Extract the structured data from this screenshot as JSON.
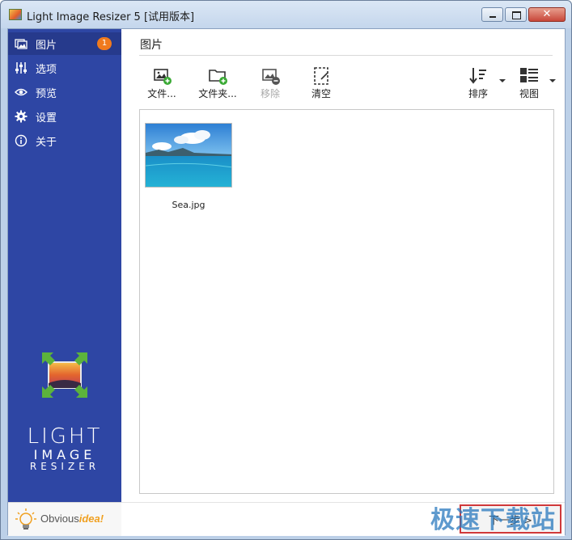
{
  "window": {
    "title": "Light Image Resizer 5  [试用版本]",
    "close_label": "✕"
  },
  "sidebar": {
    "items": [
      {
        "label": "图片",
        "icon": "images-icon",
        "badge": "1",
        "active": true
      },
      {
        "label": "选项",
        "icon": "sliders-icon"
      },
      {
        "label": "预览",
        "icon": "eye-icon"
      },
      {
        "label": "设置",
        "icon": "gear-icon"
      },
      {
        "label": "关于",
        "icon": "info-icon"
      }
    ],
    "logo": {
      "line1": "LIGHT",
      "line2": "IMAGE",
      "line3": "RESIZER"
    },
    "brand": {
      "part1": "Obvious",
      "part2": "idea!"
    }
  },
  "main": {
    "title": "图片",
    "toolbar": {
      "add_files": "文件...",
      "add_folder": "文件夹...",
      "remove": "移除",
      "clear": "清空",
      "sort": "排序",
      "view": "视图"
    },
    "files": [
      {
        "name": "Sea.jpg"
      }
    ]
  },
  "bottom": {
    "next_label": "下一步 >"
  },
  "watermark": "极速下载站",
  "colors": {
    "sidebar": "#2e46a4",
    "badge": "#f07a1d",
    "add_green": "#3aaa35"
  }
}
